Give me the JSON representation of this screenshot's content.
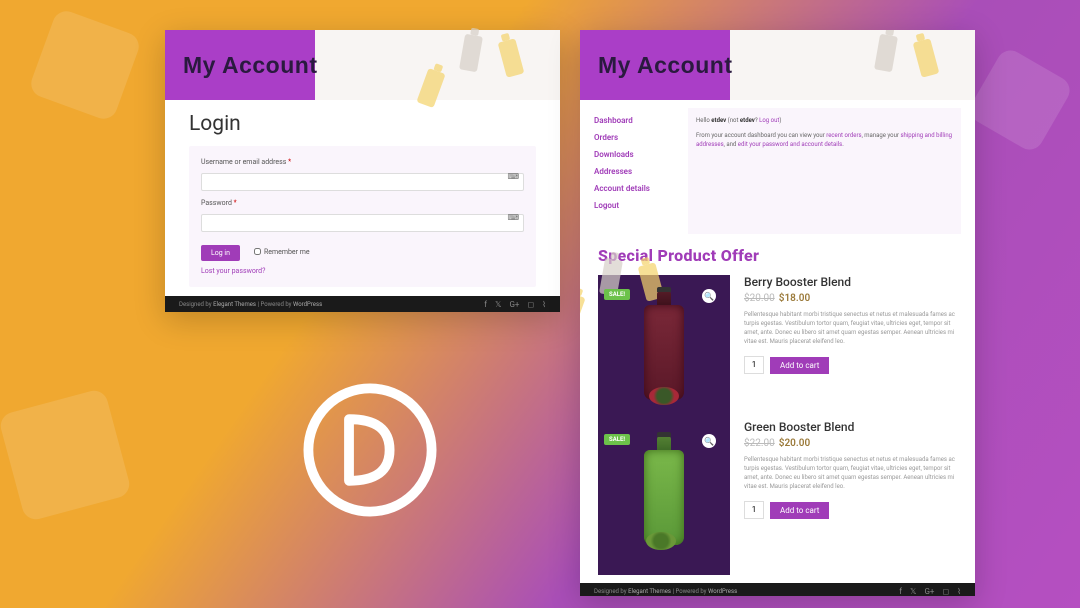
{
  "hero_title": "My Account",
  "login": {
    "heading": "Login",
    "user_label": "Username or email address ",
    "pass_label": "Password ",
    "required": "*",
    "button": "Log in",
    "remember": "Remember me",
    "lost_password": "Lost your password?"
  },
  "footer": {
    "text_prefix": "Designed by ",
    "designer": "Elegant Themes",
    "text_mid": " | Powered by ",
    "platform": "WordPress"
  },
  "account": {
    "nav": [
      "Dashboard",
      "Orders",
      "Downloads",
      "Addresses",
      "Account details",
      "Logout"
    ],
    "greeting_prefix": "Hello ",
    "username": "etdev",
    "greeting_mid": " (not ",
    "greeting_end": "? ",
    "logout": "Log out",
    "greeting_close": ")",
    "dash_text_1": "From your account dashboard you can view your ",
    "dash_link_1": "recent orders",
    "dash_text_2": ", manage your ",
    "dash_link_2": "shipping and billing addresses",
    "dash_text_3": ", and ",
    "dash_link_3": "edit your password and account details",
    "dash_text_4": "."
  },
  "offer": {
    "heading": "Special Product Offer",
    "sale_badge": "SALE!",
    "products": [
      {
        "name": "Berry Booster Blend",
        "old_price": "$20.00",
        "new_price": "$18.00",
        "desc": "Pellentesque habitant morbi tristique senectus et netus et malesuada fames ac turpis egestas. Vestibulum tortor quam, feugiat vitae, ultricies eget, tempor sit amet, ante. Donec eu libero sit amet quam egestas semper. Aenean ultricies mi vitae est. Mauris placerat eleifend leo.",
        "qty": "1",
        "button": "Add to cart"
      },
      {
        "name": "Green Booster Blend",
        "old_price": "$22.00",
        "new_price": "$20.00",
        "desc": "Pellentesque habitant morbi tristique senectus et netus et malesuada fames ac turpis egestas. Vestibulum tortor quam, feugiat vitae, ultricies eget, tempor sit amet, ante. Donec eu libero sit amet quam egestas semper. Aenean ultricies mi vitae est. Mauris placerat eleifend leo.",
        "qty": "1",
        "button": "Add to cart"
      }
    ]
  }
}
